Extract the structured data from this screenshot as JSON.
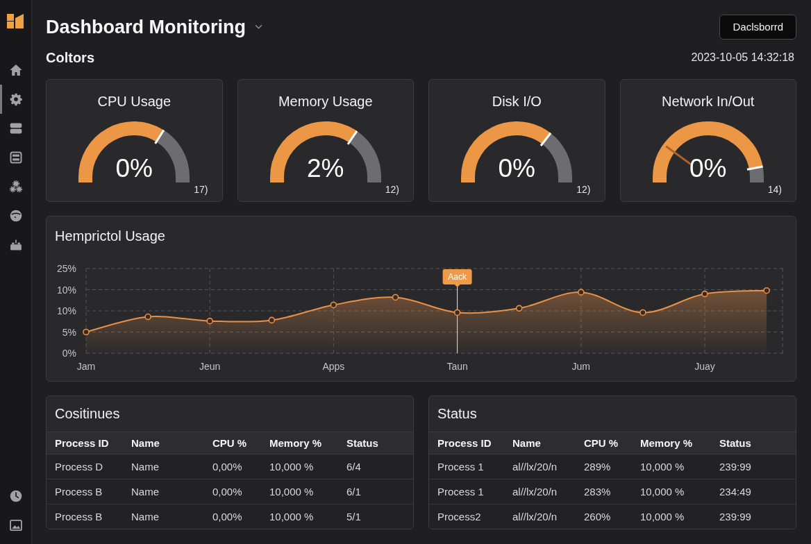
{
  "sidebar": {
    "items": [
      {
        "selected": false
      },
      {
        "selected": true
      },
      {
        "selected": false
      },
      {
        "selected": false
      },
      {
        "selected": false
      },
      {
        "selected": false
      },
      {
        "selected": false
      }
    ],
    "bottom_items": [
      {
        "selected": false
      },
      {
        "selected": false
      }
    ]
  },
  "header": {
    "title": "Dashboard Monitoring",
    "button": "Daclsborrd"
  },
  "subheader": {
    "title": "Coltors",
    "timestamp": "2023-10-05 14:32:18"
  },
  "gauges": [
    {
      "title": "CPU Usage",
      "value": "0%",
      "level": 0.68,
      "caption": "17)"
    },
    {
      "title": "Memory Usage",
      "value": "2%",
      "level": 0.69,
      "caption": "12)"
    },
    {
      "title": "Disk I/O",
      "value": "0%",
      "level": 0.71,
      "caption": "12)"
    },
    {
      "title": "Network In/Out",
      "value": "0%",
      "level": 0.94,
      "caption": "14)",
      "needle": {
        "level": 0.2
      }
    }
  ],
  "usage_chart": {
    "title": "Hemprictol Usage",
    "y_axis_labels": [
      "25%",
      "10%",
      "10%",
      "5%",
      "0%"
    ],
    "x_axis_labels": [
      "Jam",
      "Jeun",
      "Apps",
      "Taun",
      "Jum",
      "Juay"
    ],
    "tooltip": "Aack"
  },
  "tables": [
    {
      "title": "Cositinues",
      "columns": [
        "Process ID",
        "Name",
        "CPU %",
        "Memory %",
        "Status"
      ],
      "rows": [
        [
          "Process D",
          "Name",
          "0,00%",
          "10,000 %",
          "6/4"
        ],
        [
          "Process B",
          "Name",
          "0,00%",
          "10,000 %",
          "6/1"
        ],
        [
          "Process B",
          "Name",
          "0,00%",
          "10,000 %",
          "5/1"
        ]
      ]
    },
    {
      "title": "Status",
      "columns": [
        "Process ID",
        "Name",
        "CPU %",
        "Memory %",
        "Status"
      ],
      "rows": [
        [
          "Process 1",
          "al//lx/20/n",
          "289%",
          "10,000 %",
          "239:99"
        ],
        [
          "Process 1",
          "al//lx/20/n",
          "283%",
          "10,000 %",
          "234:49"
        ],
        [
          "Process2",
          "al//lx/20/n",
          "260%",
          "10,000 %",
          "239:99"
        ]
      ]
    }
  ]
}
